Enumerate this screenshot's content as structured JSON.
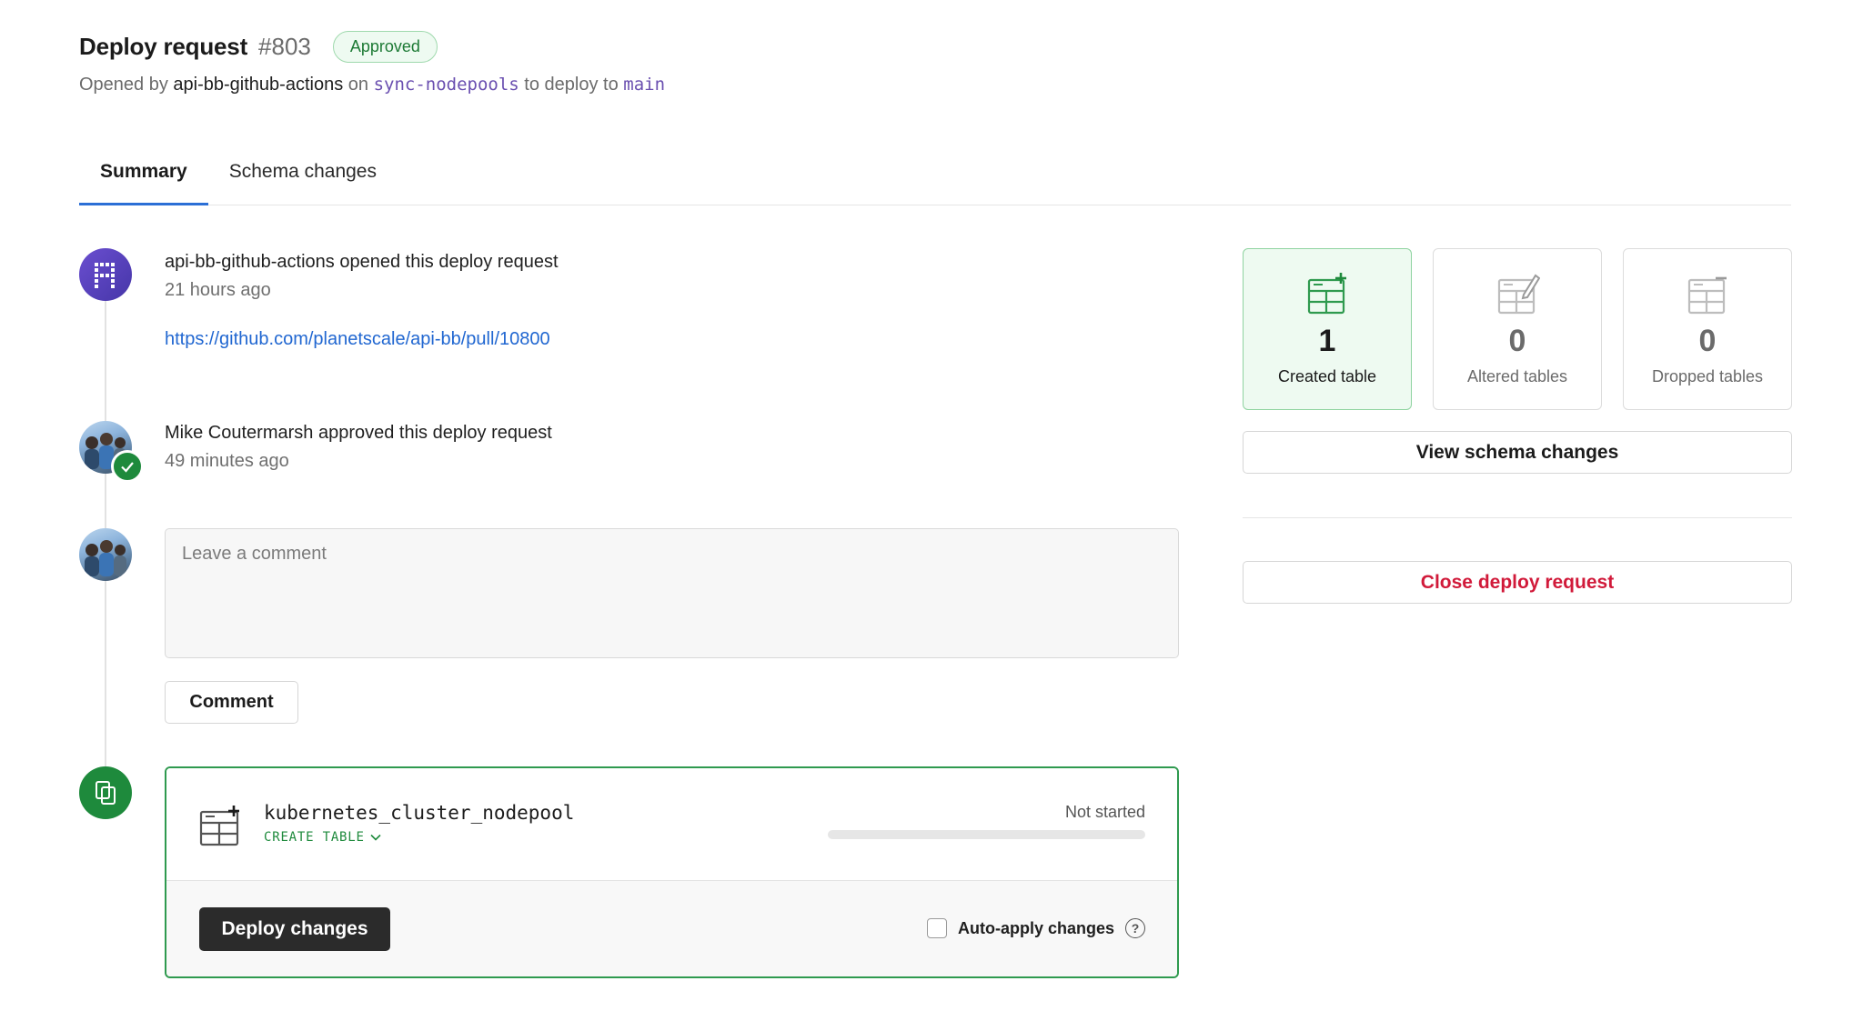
{
  "header": {
    "title": "Deploy request",
    "number": "#803",
    "status_badge": "Approved",
    "subtitle_prefix": "Opened by",
    "author": "api-bb-github-actions",
    "on_text": "on",
    "source_branch": "sync-nodepools",
    "to_text": "to deploy to",
    "target_branch": "main"
  },
  "tabs": [
    {
      "label": "Summary",
      "active": true
    },
    {
      "label": "Schema changes",
      "active": false
    }
  ],
  "timeline": {
    "opened": {
      "actor": "api-bb-github-actions",
      "action": "opened this deploy request",
      "time": "21 hours ago",
      "link": "https://github.com/planetscale/api-bb/pull/10800"
    },
    "approved": {
      "actor": "Mike Coutermarsh",
      "action": "approved this deploy request",
      "time": "49 minutes ago"
    },
    "comment": {
      "placeholder": "Leave a comment",
      "button_label": "Comment"
    }
  },
  "deploy_card": {
    "table_name": "kubernetes_cluster_nodepool",
    "operation": "CREATE TABLE",
    "status": "Not started",
    "progress": 0,
    "deploy_button": "Deploy changes",
    "auto_apply_label": "Auto-apply changes",
    "auto_apply_checked": false,
    "help_glyph": "?"
  },
  "stats": {
    "created": {
      "value": "1",
      "label": "Created table",
      "icon": "table-plus-icon"
    },
    "altered": {
      "value": "0",
      "label": "Altered tables",
      "icon": "table-edit-icon"
    },
    "dropped": {
      "value": "0",
      "label": "Dropped tables",
      "icon": "table-minus-icon"
    }
  },
  "actions": {
    "view_schema": "View schema changes",
    "close_request": "Close deploy request"
  },
  "colors": {
    "accent_blue": "#2b6fd6",
    "success_green": "#1e8a3c",
    "danger_red": "#d11a3a",
    "branch_purple": "#6a4fb0"
  }
}
